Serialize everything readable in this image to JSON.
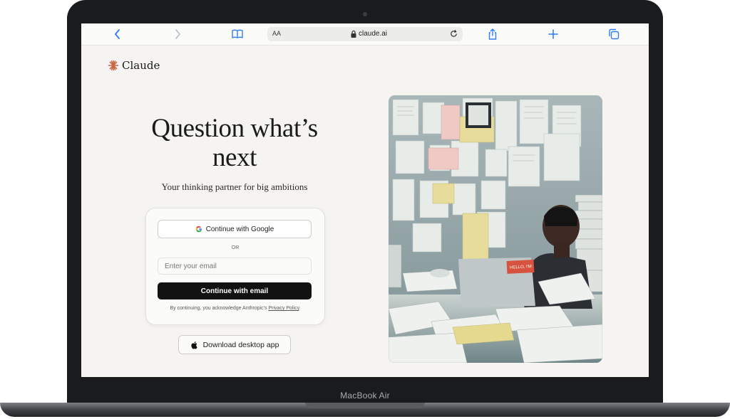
{
  "device": {
    "label": "MacBook Air"
  },
  "browser": {
    "text_size_label": "AA",
    "url": "claude.ai",
    "icons": [
      "back-icon",
      "forward-icon",
      "bookmarks-icon",
      "lock-icon",
      "reload-icon",
      "share-icon",
      "new-tab-icon",
      "tabs-icon"
    ],
    "accent_color": "#2f7cf6"
  },
  "page": {
    "brand": "Claude",
    "headline": "Question what’s next",
    "subheadline": "Your thinking partner for big ambitions",
    "login": {
      "google_button": "Continue with Google",
      "divider": "OR",
      "email_placeholder": "Enter your email",
      "email_value": "",
      "email_button": "Continue with email",
      "legal_prefix": "By continuing, you acknowledge Anthropic’s ",
      "legal_link": "Privacy Policy",
      "legal_suffix": "."
    },
    "download_button": "Download desktop app",
    "photo_sticker_text": "HELLO, I'M"
  }
}
